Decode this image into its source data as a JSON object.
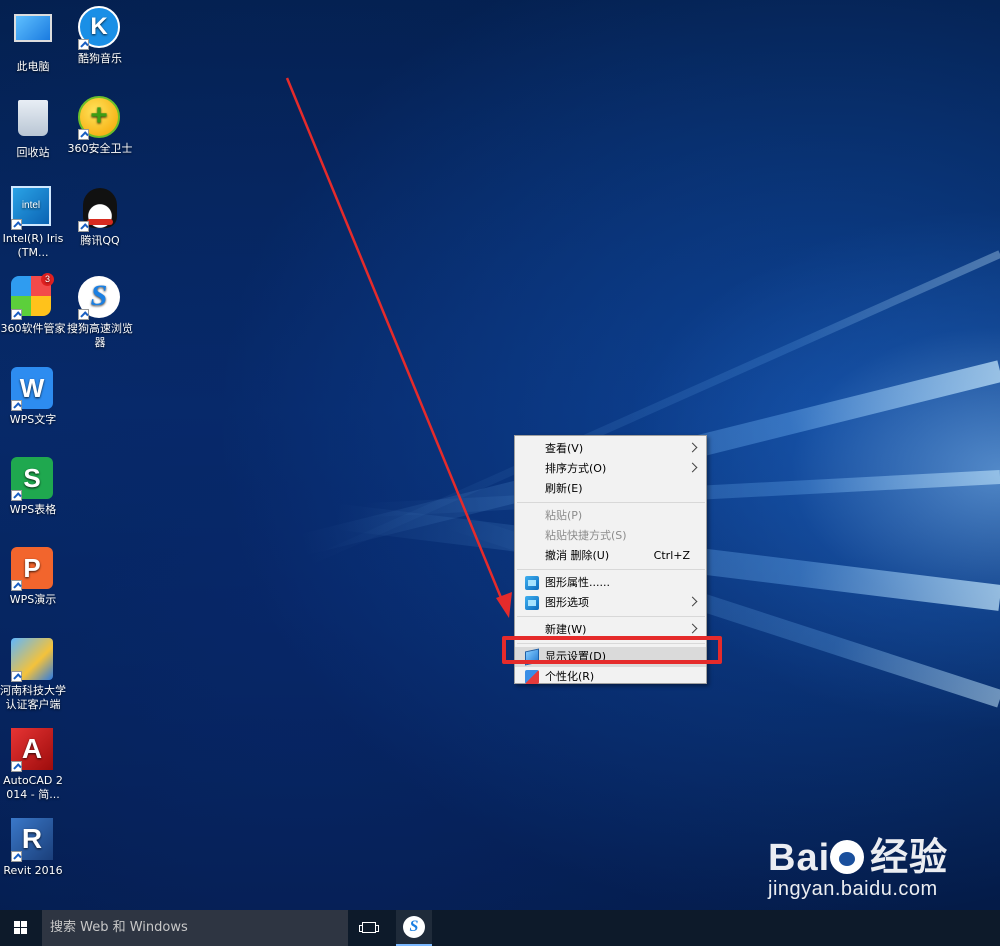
{
  "desktop": {
    "icons": [
      {
        "label": "此电脑",
        "icon": "computer-icon"
      },
      {
        "label": "酷狗音乐",
        "icon": "kugou-music-icon",
        "glyph": "K"
      },
      {
        "label": "回收站",
        "icon": "recycle-bin-icon"
      },
      {
        "label": "360安全卫士",
        "icon": "360-safe-icon",
        "glyph": "+"
      },
      {
        "label": "Intel(R) Iris(TM...",
        "icon": "intel-graphics-icon",
        "glyph": "intel"
      },
      {
        "label": "腾讯QQ",
        "icon": "qq-penguin-icon"
      },
      {
        "label": "360软件管家",
        "icon": "360-software-manager-icon",
        "badge": "3"
      },
      {
        "label": "搜狗高速浏览器",
        "icon": "sogou-browser-icon",
        "glyph": "S"
      },
      {
        "label": "WPS文字",
        "icon": "wps-writer-icon",
        "glyph": "W"
      },
      {
        "label": "WPS表格",
        "icon": "wps-spreadsheet-icon",
        "glyph": "S"
      },
      {
        "label": "WPS演示",
        "icon": "wps-presentation-icon",
        "glyph": "P"
      },
      {
        "label": "河南科技大学认证客户端",
        "icon": "network-auth-client-icon"
      },
      {
        "label": "AutoCAD 2014 - 简...",
        "icon": "autocad-icon",
        "glyph": "A"
      },
      {
        "label": "Revit 2016",
        "icon": "revit-icon",
        "glyph": "R"
      }
    ]
  },
  "context_menu": {
    "view": "查看(V)",
    "sort": "排序方式(O)",
    "refresh": "刷新(E)",
    "paste": "粘贴(P)",
    "paste_shortcut": "粘贴快捷方式(S)",
    "undo_delete": "撤消 删除(U)",
    "undo_shortcut": "Ctrl+Z",
    "graphics_properties": "图形属性......",
    "graphics_options": "图形选项",
    "new": "新建(W)",
    "display_settings": "显示设置(D)",
    "personalize": "个性化(R)"
  },
  "watermark": {
    "brand_left": "Bai",
    "brand_right": "经验",
    "url": "jingyan.baidu.com"
  },
  "taskbar": {
    "search_placeholder": "搜索 Web 和 Windows",
    "pinned_app_glyph": "S"
  },
  "colors": {
    "highlight_red": "#e52b2b",
    "taskbar_bg": "#0d1a2a",
    "menu_bg": "#f2f2f2"
  }
}
